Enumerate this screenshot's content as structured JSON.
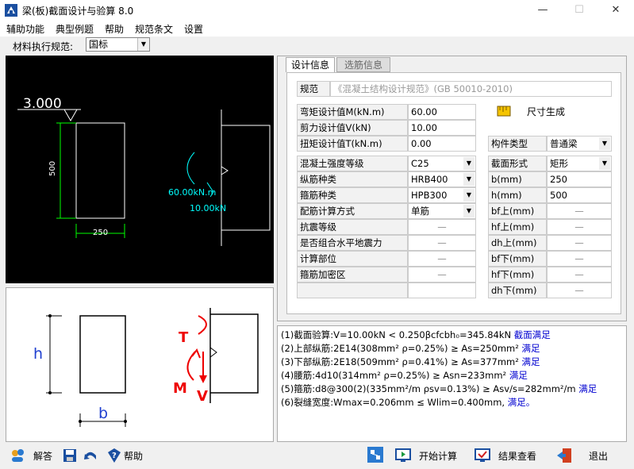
{
  "window": {
    "title": "梁(板)截面设计与验算 8.0",
    "minimize": "—",
    "maximize": "☐",
    "close": "✕"
  },
  "menu": [
    "辅助功能",
    "典型例题",
    "帮助",
    "规范条文",
    "设置"
  ],
  "material": {
    "label": "材料执行规范:",
    "value": "国标"
  },
  "drawing_top": {
    "elevation": "3.000",
    "height_dim": "500",
    "width_dim": "250",
    "moment": "60.00kN.m",
    "shear": "10.00kN"
  },
  "drawing_bottom": {
    "h": "h",
    "b": "b",
    "t": "T",
    "m": "M",
    "v": "V"
  },
  "tabs": {
    "design": "设计信息",
    "rebar": "选筋信息"
  },
  "code": {
    "label": "规范",
    "value": "《混凝土结构设计规范》(GB 50010-2010)"
  },
  "size_gen": "尺寸生成",
  "loads": [
    {
      "label": "弯矩设计值M(kN.m)",
      "value": "60.00"
    },
    {
      "label": "剪力设计值V(kN)",
      "value": "10.00"
    },
    {
      "label": "扭矩设计值T(kN.m)",
      "value": "0.00"
    }
  ],
  "member_type": {
    "label": "构件类型",
    "value": "普通梁"
  },
  "material_params": [
    {
      "label": "混凝土强度等级",
      "value": "C25",
      "dropdown": true
    },
    {
      "label": "纵筋种类",
      "value": "HRB400",
      "dropdown": true
    },
    {
      "label": "箍筋种类",
      "value": "HPB300",
      "dropdown": true
    },
    {
      "label": "配筋计算方式",
      "value": "单筋",
      "dropdown": true
    },
    {
      "label": "抗震等级",
      "value": "—",
      "dropdown": false
    },
    {
      "label": "是否组合水平地震力",
      "value": "—",
      "dropdown": false
    },
    {
      "label": "计算部位",
      "value": "—",
      "dropdown": false
    },
    {
      "label": "箍筋加密区",
      "value": "—",
      "dropdown": false
    },
    {
      "label": "",
      "value": "",
      "dropdown": false
    }
  ],
  "section_params": [
    {
      "label": "截面形式",
      "value": "矩形",
      "dropdown": true
    },
    {
      "label": "b(mm)",
      "value": "250",
      "dropdown": false
    },
    {
      "label": "h(mm)",
      "value": "500",
      "dropdown": false
    },
    {
      "label": "bf上(mm)",
      "value": "—",
      "dropdown": false
    },
    {
      "label": "hf上(mm)",
      "value": "—",
      "dropdown": false
    },
    {
      "label": "dh上(mm)",
      "value": "—",
      "dropdown": false
    },
    {
      "label": "bf下(mm)",
      "value": "—",
      "dropdown": false
    },
    {
      "label": "hf下(mm)",
      "value": "—",
      "dropdown": false
    },
    {
      "label": "dh下(mm)",
      "value": "—",
      "dropdown": false
    }
  ],
  "results": [
    {
      "text": "(1)截面验算:V=10.00kN < 0.250βcfcbh₀=345.84kN ",
      "status": "截面满足"
    },
    {
      "text": "(2)上部纵筋:2E14(308mm² ρ=0.25%) ≥ As=250mm² ",
      "status": "满足"
    },
    {
      "text": "(3)下部纵筋:2E18(509mm² ρ=0.41%) ≥ As=377mm² ",
      "status": "满足"
    },
    {
      "text": "(4)腰筋:4d10(314mm² ρ=0.25%) ≥ Asn=233mm² ",
      "status": "满足"
    },
    {
      "text": "(5)箍筋:d8@300(2)(335mm²/m ρsv=0.13%) ≥ Asv/s=282mm²/m ",
      "status": "满足"
    },
    {
      "text": "(6)裂缝宽度:Wmax=0.206mm ≤ Wlim=0.400mm, ",
      "status": "满足。"
    }
  ],
  "toolbar": {
    "solve": "解答",
    "help": "帮助",
    "start": "开始计算",
    "view": "结果查看",
    "exit": "退出"
  }
}
